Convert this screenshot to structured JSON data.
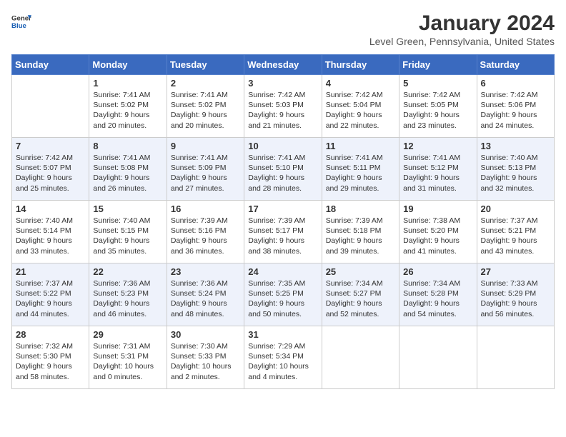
{
  "header": {
    "logo_general": "General",
    "logo_blue": "Blue",
    "month_title": "January 2024",
    "location": "Level Green, Pennsylvania, United States"
  },
  "calendar": {
    "days_of_week": [
      "Sunday",
      "Monday",
      "Tuesday",
      "Wednesday",
      "Thursday",
      "Friday",
      "Saturday"
    ],
    "weeks": [
      [
        {
          "day": "",
          "info": ""
        },
        {
          "day": "1",
          "info": "Sunrise: 7:41 AM\nSunset: 5:02 PM\nDaylight: 9 hours\nand 20 minutes."
        },
        {
          "day": "2",
          "info": "Sunrise: 7:41 AM\nSunset: 5:02 PM\nDaylight: 9 hours\nand 20 minutes."
        },
        {
          "day": "3",
          "info": "Sunrise: 7:42 AM\nSunset: 5:03 PM\nDaylight: 9 hours\nand 21 minutes."
        },
        {
          "day": "4",
          "info": "Sunrise: 7:42 AM\nSunset: 5:04 PM\nDaylight: 9 hours\nand 22 minutes."
        },
        {
          "day": "5",
          "info": "Sunrise: 7:42 AM\nSunset: 5:05 PM\nDaylight: 9 hours\nand 23 minutes."
        },
        {
          "day": "6",
          "info": "Sunrise: 7:42 AM\nSunset: 5:06 PM\nDaylight: 9 hours\nand 24 minutes."
        }
      ],
      [
        {
          "day": "7",
          "info": "Sunrise: 7:42 AM\nSunset: 5:07 PM\nDaylight: 9 hours\nand 25 minutes."
        },
        {
          "day": "8",
          "info": "Sunrise: 7:41 AM\nSunset: 5:08 PM\nDaylight: 9 hours\nand 26 minutes."
        },
        {
          "day": "9",
          "info": "Sunrise: 7:41 AM\nSunset: 5:09 PM\nDaylight: 9 hours\nand 27 minutes."
        },
        {
          "day": "10",
          "info": "Sunrise: 7:41 AM\nSunset: 5:10 PM\nDaylight: 9 hours\nand 28 minutes."
        },
        {
          "day": "11",
          "info": "Sunrise: 7:41 AM\nSunset: 5:11 PM\nDaylight: 9 hours\nand 29 minutes."
        },
        {
          "day": "12",
          "info": "Sunrise: 7:41 AM\nSunset: 5:12 PM\nDaylight: 9 hours\nand 31 minutes."
        },
        {
          "day": "13",
          "info": "Sunrise: 7:40 AM\nSunset: 5:13 PM\nDaylight: 9 hours\nand 32 minutes."
        }
      ],
      [
        {
          "day": "14",
          "info": "Sunrise: 7:40 AM\nSunset: 5:14 PM\nDaylight: 9 hours\nand 33 minutes."
        },
        {
          "day": "15",
          "info": "Sunrise: 7:40 AM\nSunset: 5:15 PM\nDaylight: 9 hours\nand 35 minutes."
        },
        {
          "day": "16",
          "info": "Sunrise: 7:39 AM\nSunset: 5:16 PM\nDaylight: 9 hours\nand 36 minutes."
        },
        {
          "day": "17",
          "info": "Sunrise: 7:39 AM\nSunset: 5:17 PM\nDaylight: 9 hours\nand 38 minutes."
        },
        {
          "day": "18",
          "info": "Sunrise: 7:39 AM\nSunset: 5:18 PM\nDaylight: 9 hours\nand 39 minutes."
        },
        {
          "day": "19",
          "info": "Sunrise: 7:38 AM\nSunset: 5:20 PM\nDaylight: 9 hours\nand 41 minutes."
        },
        {
          "day": "20",
          "info": "Sunrise: 7:37 AM\nSunset: 5:21 PM\nDaylight: 9 hours\nand 43 minutes."
        }
      ],
      [
        {
          "day": "21",
          "info": "Sunrise: 7:37 AM\nSunset: 5:22 PM\nDaylight: 9 hours\nand 44 minutes."
        },
        {
          "day": "22",
          "info": "Sunrise: 7:36 AM\nSunset: 5:23 PM\nDaylight: 9 hours\nand 46 minutes."
        },
        {
          "day": "23",
          "info": "Sunrise: 7:36 AM\nSunset: 5:24 PM\nDaylight: 9 hours\nand 48 minutes."
        },
        {
          "day": "24",
          "info": "Sunrise: 7:35 AM\nSunset: 5:25 PM\nDaylight: 9 hours\nand 50 minutes."
        },
        {
          "day": "25",
          "info": "Sunrise: 7:34 AM\nSunset: 5:27 PM\nDaylight: 9 hours\nand 52 minutes."
        },
        {
          "day": "26",
          "info": "Sunrise: 7:34 AM\nSunset: 5:28 PM\nDaylight: 9 hours\nand 54 minutes."
        },
        {
          "day": "27",
          "info": "Sunrise: 7:33 AM\nSunset: 5:29 PM\nDaylight: 9 hours\nand 56 minutes."
        }
      ],
      [
        {
          "day": "28",
          "info": "Sunrise: 7:32 AM\nSunset: 5:30 PM\nDaylight: 9 hours\nand 58 minutes."
        },
        {
          "day": "29",
          "info": "Sunrise: 7:31 AM\nSunset: 5:31 PM\nDaylight: 10 hours\nand 0 minutes."
        },
        {
          "day": "30",
          "info": "Sunrise: 7:30 AM\nSunset: 5:33 PM\nDaylight: 10 hours\nand 2 minutes."
        },
        {
          "day": "31",
          "info": "Sunrise: 7:29 AM\nSunset: 5:34 PM\nDaylight: 10 hours\nand 4 minutes."
        },
        {
          "day": "",
          "info": ""
        },
        {
          "day": "",
          "info": ""
        },
        {
          "day": "",
          "info": ""
        }
      ]
    ]
  }
}
